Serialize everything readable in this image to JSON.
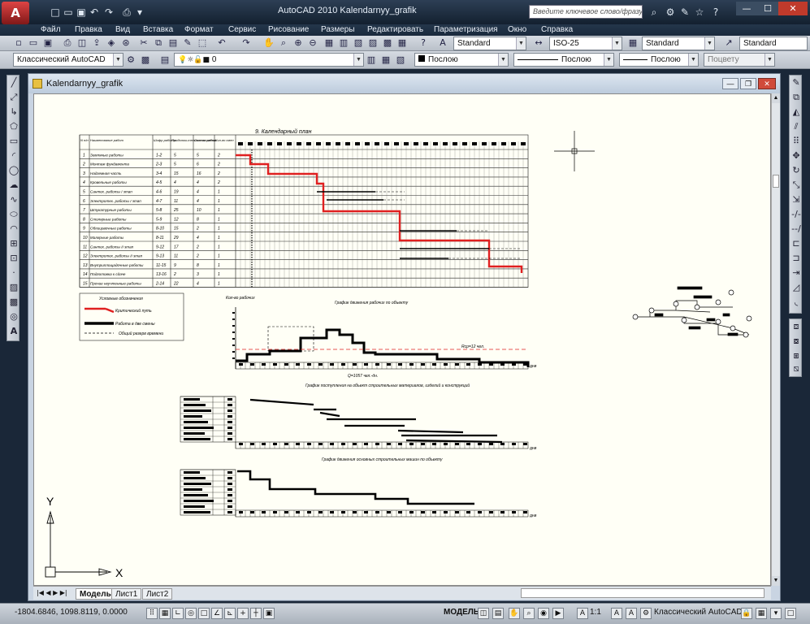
{
  "title_bar": {
    "app_button_label": "A",
    "title": "AutoCAD 2010    Kalendarnyy_grafik",
    "search_placeholder": "Введите ключевое слово/фразу",
    "quick_access": [
      "□",
      "▭",
      "▣",
      "↶",
      "↷",
      "⎙",
      "▾"
    ],
    "win_controls": [
      "—",
      "☐",
      "✕"
    ],
    "help_icons": [
      "⚙",
      "✎",
      "☆",
      "?"
    ]
  },
  "menu": [
    "Файл",
    "Правка",
    "Вид",
    "Вставка",
    "Формат",
    "Сервис",
    "Рисование",
    "Размеры",
    "Редактировать",
    "Параметризация",
    "Окно",
    "Справка"
  ],
  "toolbar1": {
    "text_style": "Standard",
    "dim_style": "ISO-25",
    "table_style": "Standard",
    "multileader_style": "Standard"
  },
  "toolbar2": {
    "workspace": "Классический AutoCAD",
    "layer": "0",
    "color": "Послою",
    "linetype": "Послою",
    "lineweight": "Послою",
    "plotstyle": "Поцвету"
  },
  "drawing": {
    "window_title": "Kalendarnyy_grafik",
    "sheet_title": "9. Календарный план",
    "table_headers": [
      "N п/п",
      "Наименование работ",
      "Шифр работы",
      "Продолжи-тельность работ",
      "Состав звена",
      "Кол-во смен"
    ],
    "rows": [
      [
        "1",
        "Земляные работы",
        "1-2",
        "5",
        "5",
        "2"
      ],
      [
        "2",
        "Монтаж фундамента",
        "2-3",
        "5",
        "6",
        "2"
      ],
      [
        "3",
        "Надземная часть",
        "3-4",
        "15",
        "16",
        "2"
      ],
      [
        "4",
        "Кровельные работы",
        "4-5",
        "4",
        "4",
        "2"
      ],
      [
        "5",
        "Сантех. работы I этап",
        "4-6",
        "19",
        "4",
        "1"
      ],
      [
        "6",
        "Электротех. работы I этап",
        "4-7",
        "11",
        "4",
        "1"
      ],
      [
        "7",
        "Штукатурные работы",
        "5-8",
        "25",
        "10",
        "1"
      ],
      [
        "8",
        "Столярные работы",
        "5-9",
        "12",
        "8",
        "1"
      ],
      [
        "9",
        "Облицовочные работы",
        "8-10",
        "15",
        "2",
        "1"
      ],
      [
        "10",
        "Малярные работы",
        "8-11",
        "29",
        "4",
        "1"
      ],
      [
        "11",
        "Сантех. работы II этап",
        "9-12",
        "17",
        "2",
        "1"
      ],
      [
        "12",
        "Электротех. работы II этап",
        "9-13",
        "11",
        "2",
        "1"
      ],
      [
        "13",
        "Внутриплощадочные работы",
        "11-15",
        "9",
        "8",
        "1"
      ],
      [
        "14",
        "Подготовка к сдаче",
        "13-16",
        "2",
        "3",
        "1"
      ],
      [
        "15",
        "Прочие неучтенные работы",
        "2-14",
        "22",
        "4",
        "1"
      ]
    ],
    "legend_title": "Условные обозначения",
    "legend": [
      "Критический путь",
      "Работа в две смены",
      "Общий резерв времени"
    ],
    "workers_title": "График движения рабочих по объекту",
    "workers_ylabel": "Кол-во рабочих",
    "workers_avg": "Rср=12 чел.",
    "workers_total": "Q=1057 чел.-дн.",
    "materials_title": "График поступления на объект строительных материалов, изделий и конструкций",
    "machines_title": "График движения основных строительных машин по объекту",
    "days_label": "дни",
    "axis_y": "Y",
    "axis_x": "X"
  },
  "tabs": [
    "Модель",
    "Лист1",
    "Лист2"
  ],
  "status": {
    "coords": "-1804.6846, 1098.8119, 0.0000",
    "model": "МОДЕЛЬ",
    "scale": "1:1",
    "workspace": "Классический AutoCAD"
  }
}
